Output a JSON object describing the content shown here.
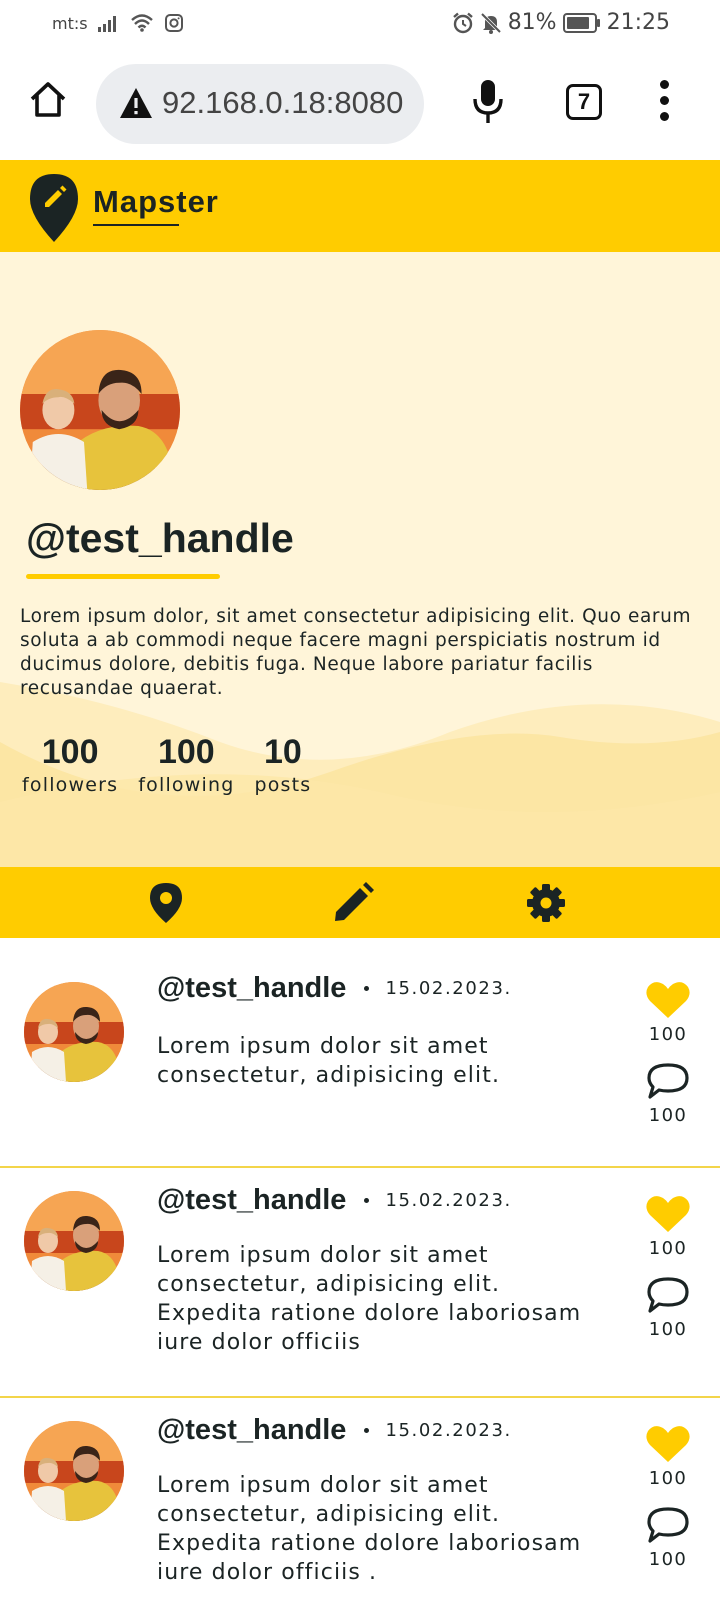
{
  "status_bar": {
    "carrier": "mt:s",
    "battery": "81%",
    "time": "21:25",
    "icons": [
      "signal-icon",
      "wifi-icon",
      "instagram-icon",
      "alarm-icon",
      "mute-icon",
      "battery-icon"
    ]
  },
  "browser": {
    "url": "92.168.0.18:8080",
    "tab_count": "7"
  },
  "app": {
    "title": "Mapster",
    "accent_color": "#ffcc00",
    "profile_bg_color": "#fff5d9",
    "text_color": "#1b2424"
  },
  "profile": {
    "handle": "@test_handle",
    "bio": "Lorem ipsum dolor, sit amet consectetur adipisicing elit. Quo earum soluta a ab commodi neque facere magni perspiciatis nostrum id ducimus dolore, debitis fuga. Neque labore pariatur facilis recusandae quaerat.",
    "stats": [
      {
        "value": "100",
        "label": "followers"
      },
      {
        "value": "100",
        "label": "following"
      },
      {
        "value": "10",
        "label": "posts"
      }
    ]
  },
  "nav": [
    "map-pin-icon",
    "pencil-icon",
    "gear-icon"
  ],
  "posts": [
    {
      "handle": "@test_handle",
      "date": "15.02.2023.",
      "text": "Lorem ipsum dolor sit amet consectetur, adipisicing elit.",
      "likes": "100",
      "comments": "100"
    },
    {
      "handle": "@test_handle",
      "date": "15.02.2023.",
      "text": "Lorem ipsum dolor sit amet consectetur, adipisicing elit. Expedita ratione dolore laboriosam iure dolor officiis",
      "likes": "100",
      "comments": "100"
    },
    {
      "handle": "@test_handle",
      "date": "15.02.2023.",
      "text": "Lorem ipsum dolor sit amet consectetur, adipisicing elit. Expedita ratione dolore laboriosam iure dolor officiis .",
      "likes": "100",
      "comments": "100"
    }
  ]
}
